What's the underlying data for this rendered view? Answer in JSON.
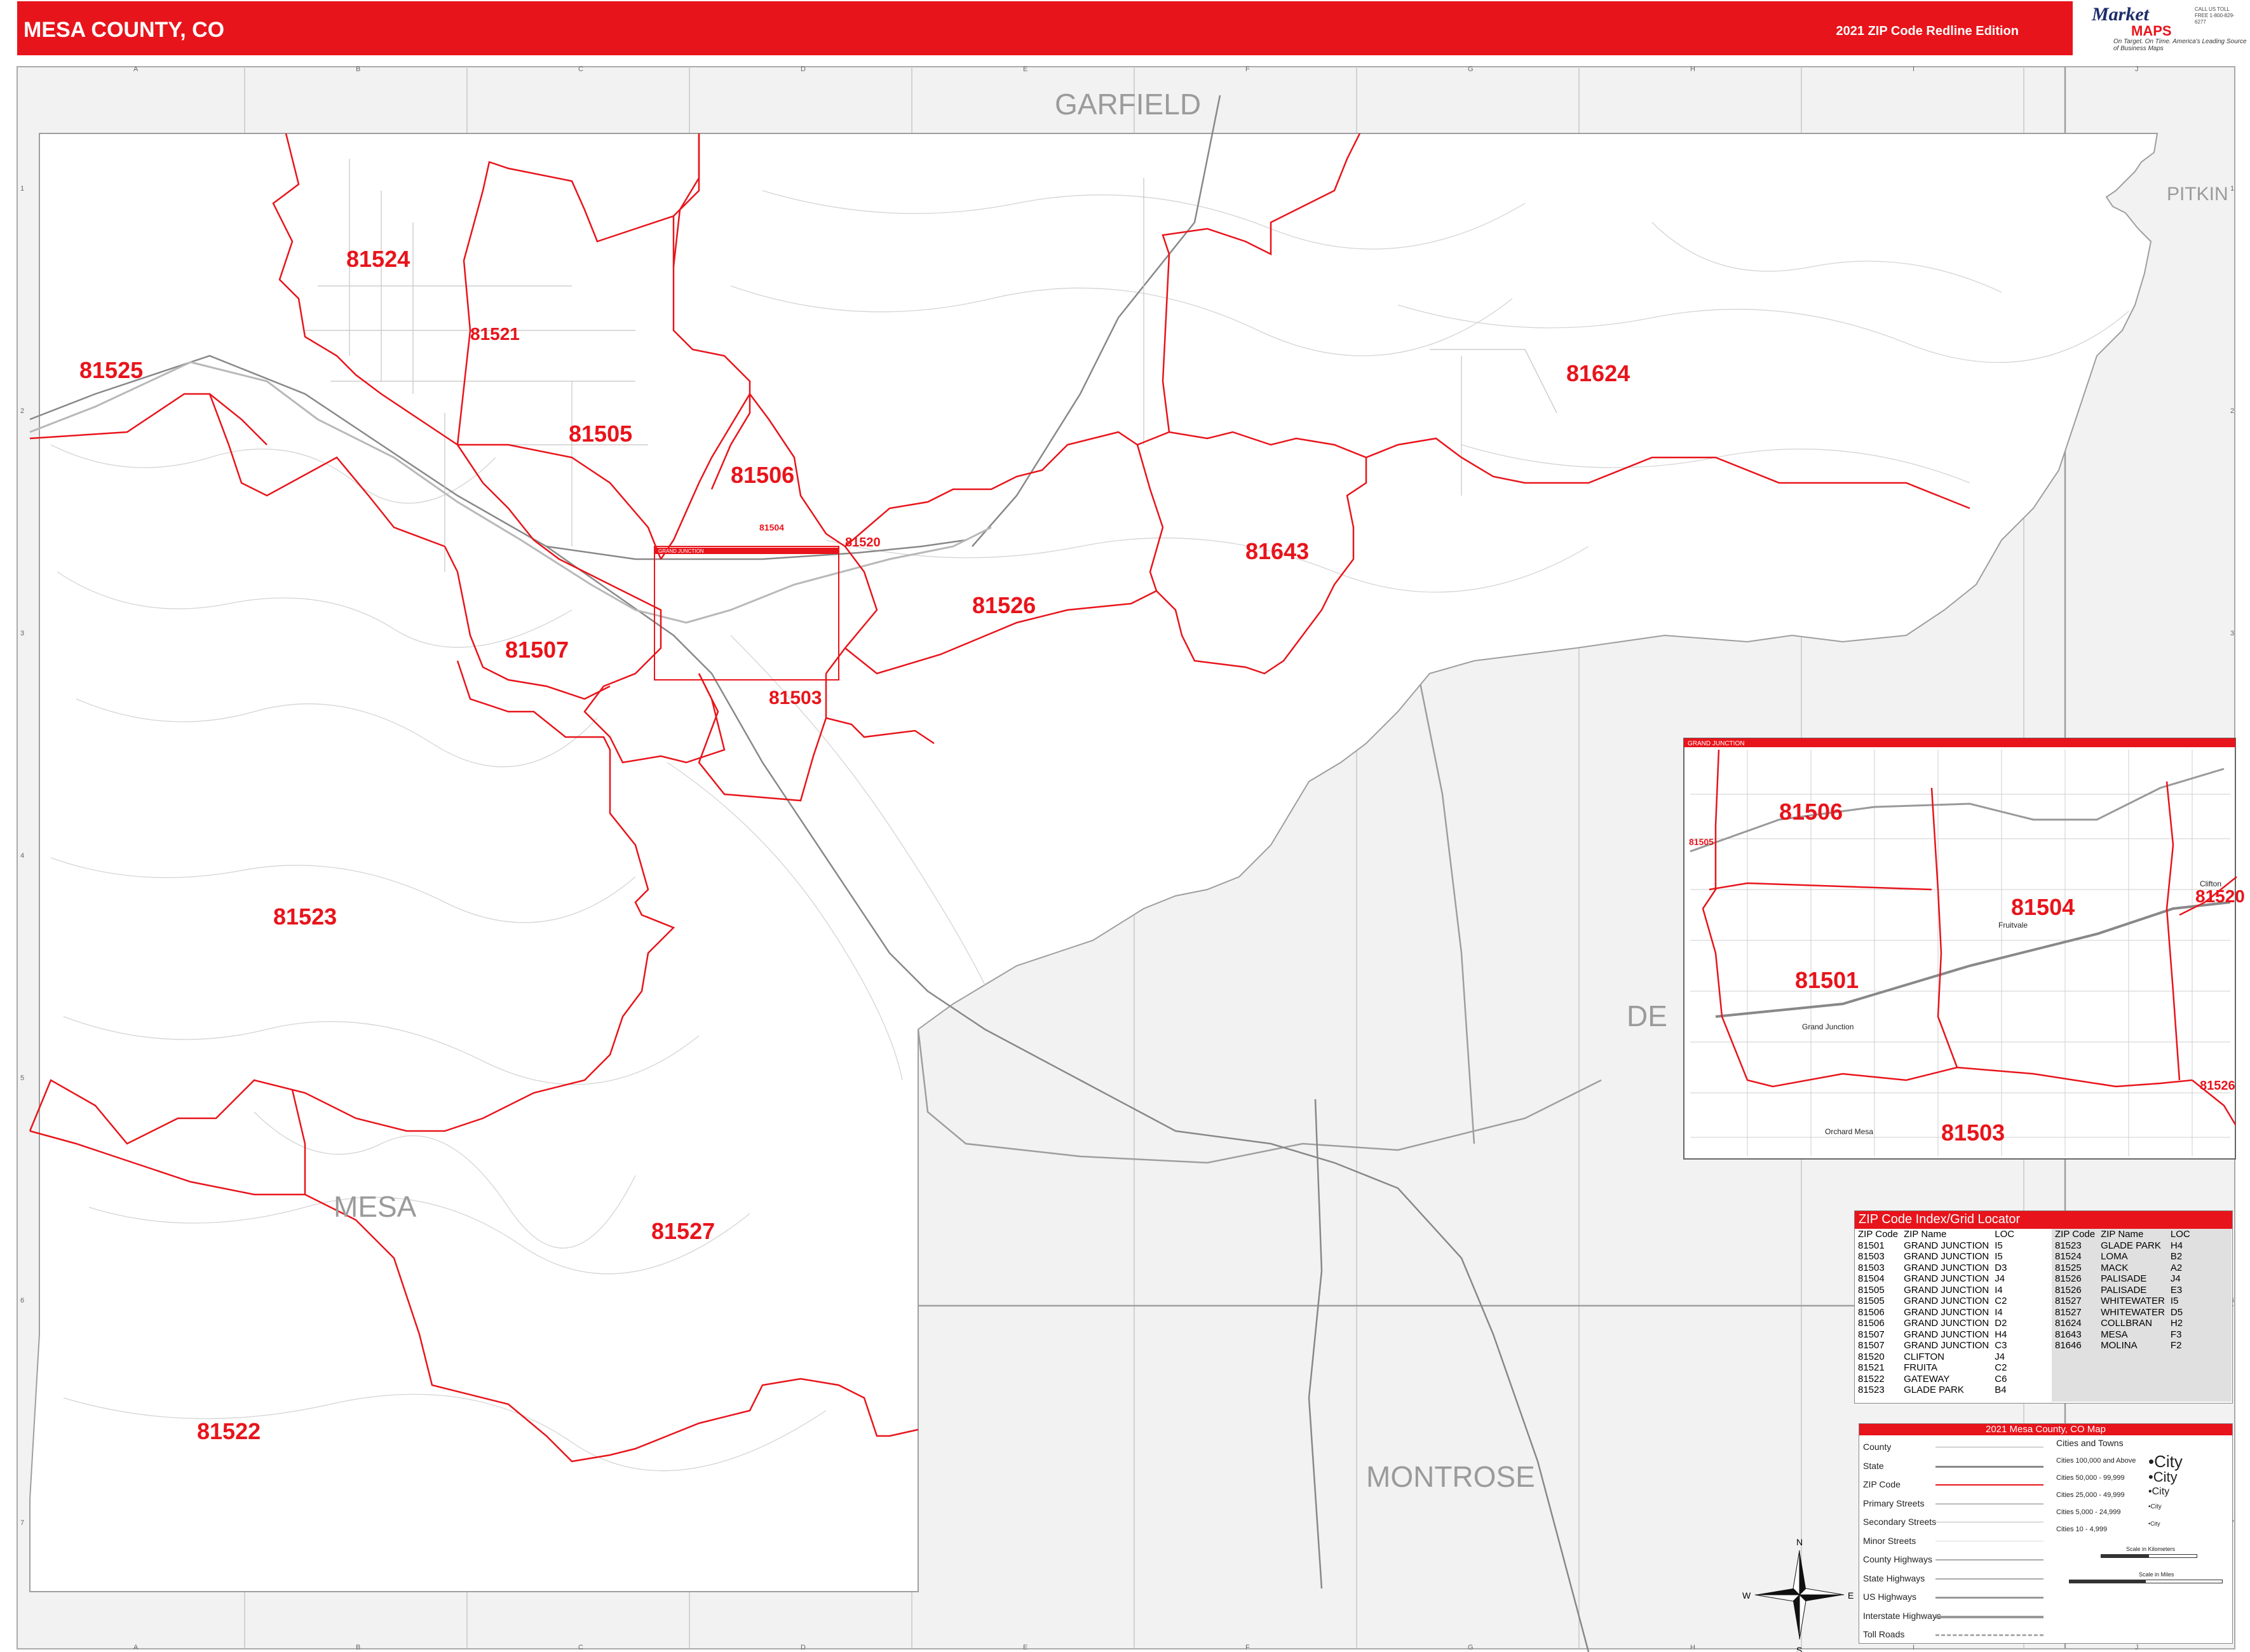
{
  "header": {
    "title": "MESA COUNTY, CO",
    "edition": "2021 ZIP Code Redline Edition",
    "colors": {
      "accent": "#e8141b",
      "county_fill": "#f2f2f2",
      "zip_line": "#e8141b"
    }
  },
  "logo": {
    "brand_top": "Market",
    "brand_bottom": "MAPS",
    "tagline_1": "On Target. On Time.",
    "tagline_2": "America's Leading Source of Business Maps",
    "contact": "CALL US TOLL FREE 1-800-829-6277"
  },
  "map": {
    "counties": [
      "GARFIELD",
      "PITKIN",
      "MESA",
      "DE",
      "MONTROSE"
    ],
    "zip_labels": [
      "81524",
      "81525",
      "81521",
      "81505",
      "81506",
      "81504",
      "81520",
      "81526",
      "81643",
      "81624",
      "81507",
      "81503",
      "81523",
      "81527",
      "81522"
    ],
    "inset_title": "GRAND JUNCTION",
    "grid_cols": [
      "A",
      "B",
      "C",
      "D",
      "E",
      "F",
      "G",
      "H",
      "I",
      "J"
    ],
    "grid_rows": [
      "1",
      "2",
      "3",
      "4",
      "5",
      "6",
      "7"
    ],
    "compass": [
      "N",
      "E",
      "S",
      "W"
    ]
  },
  "inset": {
    "title": "GRAND JUNCTION",
    "zip_labels": [
      "81506",
      "81505",
      "81504",
      "81520",
      "81501",
      "81526",
      "81503"
    ],
    "city_labels": [
      "Grand Junction",
      "Fruitvale",
      "Orchard Mesa",
      "Clifton"
    ]
  },
  "zip_index": {
    "title": "ZIP Code Index/Grid Locator",
    "headers": [
      "ZIP Code",
      "ZIP Name",
      "LOC"
    ],
    "left": [
      [
        "81501",
        "GRAND JUNCTION",
        "I5"
      ],
      [
        "81503",
        "GRAND JUNCTION",
        "I5"
      ],
      [
        "81503",
        "GRAND JUNCTION",
        "D3"
      ],
      [
        "81504",
        "GRAND JUNCTION",
        "J4"
      ],
      [
        "81505",
        "GRAND JUNCTION",
        "I4"
      ],
      [
        "81505",
        "GRAND JUNCTION",
        "C2"
      ],
      [
        "81506",
        "GRAND JUNCTION",
        "I4"
      ],
      [
        "81506",
        "GRAND JUNCTION",
        "D2"
      ],
      [
        "81507",
        "GRAND JUNCTION",
        "H4"
      ],
      [
        "81507",
        "GRAND JUNCTION",
        "C3"
      ],
      [
        "81520",
        "CLIFTON",
        "J4"
      ],
      [
        "81521",
        "FRUITA",
        "C2"
      ],
      [
        "81522",
        "GATEWAY",
        "C6"
      ],
      [
        "81523",
        "GLADE PARK",
        "B4"
      ]
    ],
    "right": [
      [
        "81523",
        "GLADE PARK",
        "H4"
      ],
      [
        "81524",
        "LOMA",
        "B2"
      ],
      [
        "81525",
        "MACK",
        "A2"
      ],
      [
        "81526",
        "PALISADE",
        "J4"
      ],
      [
        "81526",
        "PALISADE",
        "E3"
      ],
      [
        "81527",
        "WHITEWATER",
        "I5"
      ],
      [
        "81527",
        "WHITEWATER",
        "D5"
      ],
      [
        "81624",
        "COLLBRAN",
        "H2"
      ],
      [
        "81643",
        "MESA",
        "F3"
      ],
      [
        "81646",
        "MOLINA",
        "F2"
      ]
    ]
  },
  "legend": {
    "title": "2021 Mesa County, CO Map",
    "lines": [
      "County",
      "State",
      "ZIP Code",
      "Primary Streets",
      "Secondary Streets",
      "Minor Streets",
      "County Highways",
      "State Highways",
      "US Highways",
      "Interstate Highways",
      "Toll Roads"
    ],
    "cities_title": "Cities and Towns",
    "cities": [
      {
        "range": "Cities 100,000 and Above",
        "sample": "City"
      },
      {
        "range": "Cities 50,000 - 99,999",
        "sample": "City"
      },
      {
        "range": "Cities 25,000 - 49,999",
        "sample": "City"
      },
      {
        "range": "Cities 5,000 - 24,999",
        "sample": "City"
      },
      {
        "range": "Cities 10 - 4,999",
        "sample": "City"
      }
    ],
    "scale_km": "Scale in Kilometers",
    "scale_mi": "Scale in Miles"
  }
}
